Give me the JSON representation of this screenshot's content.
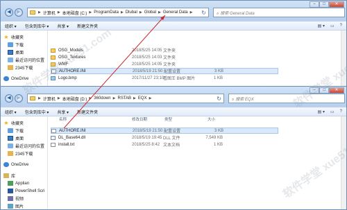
{
  "window1": {
    "breadcrumbs": [
      "计算机",
      "本地磁盘 (C:)",
      "ProgramData",
      "Dlubal",
      "Global",
      "General Data"
    ],
    "search_placeholder": "搜索 General Data",
    "toolbar": {
      "organize": "组织 ▾",
      "include_library": "包含到库中 ▾",
      "share": "共享 ▾",
      "new_folder": "新建文件夹"
    },
    "nav": [
      {
        "label": "收藏夹",
        "icon": "star-icon"
      },
      {
        "label": "下载",
        "icon": "download-folder-icon"
      },
      {
        "label": "桌面",
        "icon": "desktop-icon"
      },
      {
        "label": "最近访问的位置",
        "icon": "recent-places-icon"
      },
      {
        "label": "2345下载",
        "icon": "folder-icon"
      },
      {
        "label": "OneDrive",
        "icon": "onedrive-icon"
      }
    ],
    "files": [
      {
        "name": "OSG_Models",
        "date": "2018/5/25 14:05",
        "type": "文件夹",
        "size": "",
        "icon": "folder"
      },
      {
        "name": "OSG_Textures",
        "date": "2018/5/25 14:03",
        "type": "文件夹",
        "size": "",
        "icon": "folder"
      },
      {
        "name": "WMF",
        "date": "2018/5/25 14:05",
        "type": "文件夹",
        "size": "",
        "icon": "folder"
      },
      {
        "name": "AUTHORE.INI",
        "date": "2018/5/19 21:50",
        "type": "配置设置",
        "size": "3 KB",
        "icon": "ini"
      },
      {
        "name": "Logo.bmp",
        "date": "2017/11/27 23:10",
        "type": "看图王 BMP 图片",
        "size": "1 KB",
        "icon": "bmp"
      }
    ]
  },
  "window2": {
    "breadcrumbs": [
      "计算机",
      "本地磁盘 (D:)",
      "360down",
      "RSTAB",
      "EQX"
    ],
    "search_placeholder": "搜索 EQX",
    "toolbar": {
      "organize": "组织 ▾",
      "include_library": "包含到库中 ▾",
      "share": "共享 ▾",
      "new_folder": "新建文件夹"
    },
    "nav": [
      {
        "label": "收藏夹",
        "icon": "star-icon",
        "sub": false,
        "gap": false
      },
      {
        "label": "下载",
        "icon": "download-folder-icon",
        "sub": true,
        "gap": false
      },
      {
        "label": "桌面",
        "icon": "desktop-icon",
        "sub": true,
        "gap": false
      },
      {
        "label": "最近访问的位置",
        "icon": "recent-places-icon",
        "sub": true,
        "gap": false
      },
      {
        "label": "2345下载",
        "icon": "folder-icon",
        "sub": true,
        "gap": false
      },
      {
        "label": "OneDrive",
        "icon": "onedrive-icon",
        "sub": false,
        "gap": true
      },
      {
        "label": "库",
        "icon": "library-icon",
        "sub": false,
        "gap": true
      },
      {
        "label": "Applian",
        "icon": "library-folder-icon",
        "sub": true,
        "gap": false
      },
      {
        "label": "PowerShell Scri",
        "icon": "powershell-icon",
        "sub": true,
        "gap": false
      },
      {
        "label": "视频",
        "icon": "videos-icon",
        "sub": true,
        "gap": false
      },
      {
        "label": "图片",
        "icon": "pictures-icon",
        "sub": true,
        "gap": false
      },
      {
        "label": "文档",
        "icon": "documents-icon",
        "sub": true,
        "gap": false
      }
    ],
    "header": {
      "name": "名称",
      "date": "修改日期",
      "type": "类型",
      "size": "大小"
    },
    "files": [
      {
        "name": "AUTHORE.INI",
        "date": "2018/5/19 21:50",
        "type": "配置设置",
        "size": "3 KB",
        "icon": "ini"
      },
      {
        "name": "DL_Base64.dll",
        "date": "2018/5/19 19:45",
        "type": "DLL 文件",
        "size": "7,549 KB",
        "icon": "dll"
      },
      {
        "name": "install.txt",
        "date": "2018/5/25 8:42",
        "type": "文本文档",
        "size": "1 KB",
        "icon": "txt"
      }
    ]
  },
  "watermark": "软件学堂 xue51.com",
  "colors": {
    "arrow": "#d02828",
    "selection": "#d9e9fb",
    "titlebar": "#cfe1f5"
  }
}
